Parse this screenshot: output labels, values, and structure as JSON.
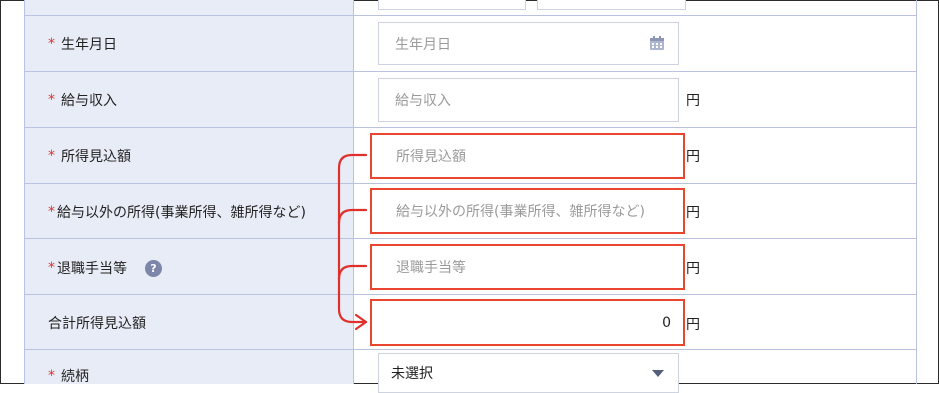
{
  "form": {
    "rows": [
      {
        "label": "生年月日",
        "required": true,
        "placeholder": "生年月日"
      },
      {
        "label": "給与収入",
        "required": true,
        "placeholder": "給与収入",
        "unit": "円"
      },
      {
        "label": "所得見込額",
        "required": true,
        "placeholder": "所得見込額",
        "unit": "円"
      },
      {
        "label": "給与以外の所得(事業所得、雑所得など)",
        "required": true,
        "placeholder": "給与以外の所得(事業所得、雑所得など)",
        "unit": "円"
      },
      {
        "label": "退職手当等",
        "required": true,
        "placeholder": "退職手当等",
        "unit": "円",
        "help": "?"
      },
      {
        "label": "合計所得見込額",
        "required": false,
        "value": "0",
        "unit": "円"
      },
      {
        "label": "続柄",
        "required": true,
        "selected": "未選択"
      }
    ],
    "required_mark": "*"
  },
  "colors": {
    "label_bg": "#e8ecf6",
    "border": "#b9c2de",
    "highlight": "#e9452f",
    "arrow": "#e0302c",
    "required": "#e0302c"
  },
  "icons": [
    "calendar-icon",
    "help-icon",
    "dropdown-caret-icon",
    "arrow-connector"
  ]
}
